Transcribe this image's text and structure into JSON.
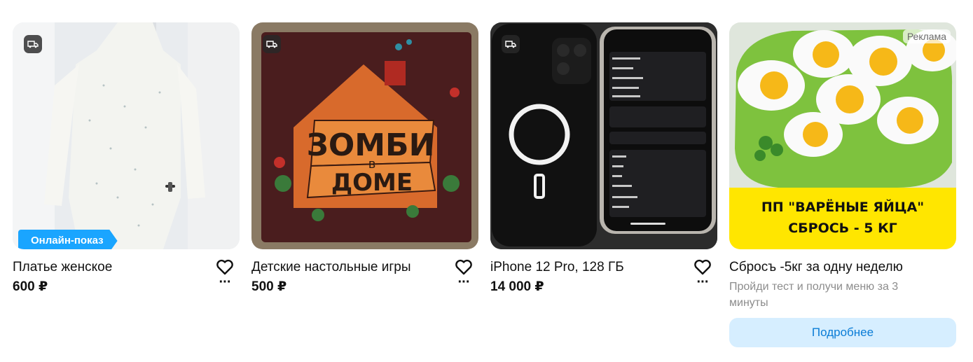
{
  "cards": [
    {
      "title": "Платье женское",
      "price": "600 ₽",
      "badge": "Онлайн-показ",
      "icons": [
        "delivery-icon",
        "heart-icon",
        "more-icon"
      ]
    },
    {
      "title": "Детские настольные игры",
      "price": "500 ₽",
      "cover_text_line1": "ЗОМБИ",
      "cover_text_small": "в",
      "cover_text_line2": "ДОМЕ",
      "icons": [
        "delivery-icon",
        "heart-icon",
        "more-icon"
      ]
    },
    {
      "title": "iPhone 12 Pro, 128 ГБ",
      "price": "14 000 ₽",
      "icons": [
        "delivery-icon",
        "heart-icon",
        "more-icon"
      ]
    }
  ],
  "ad": {
    "label": "Реклама",
    "banner_line1": "ПП \"ВАРЁНЫЕ ЯЙЦА\"",
    "banner_line2": "СБРОСЬ - 5 КГ",
    "title": "Сбросъ -5кг за одну неделю",
    "subtitle": "Пройди тест и получи меню за 3 минуты",
    "button": "Подробнее"
  },
  "colors": {
    "badge_blue": "#1aa5ff",
    "ad_button_bg": "#d6eeff",
    "ad_button_text": "#0a7cd6",
    "banner_yellow": "#ffe600"
  }
}
